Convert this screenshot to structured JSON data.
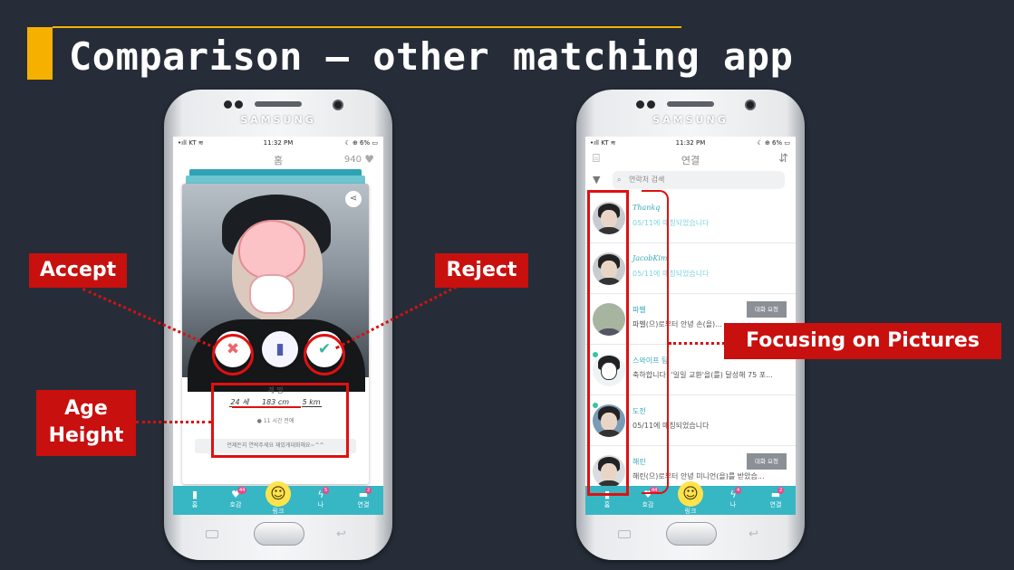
{
  "slide": {
    "title": "Comparison – other matching app",
    "annotations": {
      "accept": "Accept",
      "reject": "Reject",
      "age_line1": "Age",
      "age_line2": "Height",
      "focus": "Focusing on Pictures"
    }
  },
  "colors": {
    "accent": "#f6b100",
    "tag_red": "#c8100f",
    "app_teal": "#37b6c4"
  },
  "phone_left": {
    "brand": "SAMSUNG",
    "status": {
      "carrier": "•ıll KT ≋",
      "time": "11:32 PM",
      "battery": "☾ ⊕ 6% ▭"
    },
    "header": {
      "title": "홈",
      "points": "940",
      "heart_icon": "heart-icon"
    },
    "card": {
      "name": "계 명",
      "age": "24 세",
      "height": "183 cm",
      "distance": "5 km",
      "last_active": "11 시간 전에",
      "message": "언제든지 연락주세요 재밌게대화해요~^^"
    },
    "tabs": [
      {
        "label": "홈",
        "icon": "▮",
        "badge": ""
      },
      {
        "label": "호감",
        "icon": "♥",
        "badge": "44"
      },
      {
        "label": "링크",
        "icon": "☺",
        "badge": ""
      },
      {
        "label": "나",
        "icon": "ϟ",
        "badge": "5"
      },
      {
        "label": "연결",
        "icon": "▬",
        "badge": "2"
      }
    ]
  },
  "phone_right": {
    "brand": "SAMSUNG",
    "status": {
      "carrier": "•ıll KT ≋",
      "time": "11:32 PM",
      "battery": "☾ ⊕ 6% ▭"
    },
    "header": {
      "title": "연결"
    },
    "search": {
      "placeholder": "연락처 검색"
    },
    "chats": [
      {
        "name": "Thankq",
        "message": "05/11에 매칭되었습니다",
        "request": ""
      },
      {
        "name": "JacobKim",
        "message": "05/11에 매칭되었습니다",
        "request": ""
      },
      {
        "name": "파벨",
        "message": "파벨(으)로부터 안녕 손(을)...",
        "request": "대화 요청"
      },
      {
        "name": "스와이프 팀",
        "message": "축하합니다! '일일 교환'을(를) 달성해 75 포...",
        "request": ""
      },
      {
        "name": "도전",
        "message": "05/11에 매칭되었습니다",
        "request": ""
      },
      {
        "name": "해린",
        "message": "해린(으)로부터 안녕 미니언(을)를 받았습...",
        "request": "대화 요청"
      }
    ],
    "tabs": [
      {
        "label": "홈",
        "icon": "▮",
        "badge": ""
      },
      {
        "label": "호감",
        "icon": "♥",
        "badge": "44"
      },
      {
        "label": "링크",
        "icon": "☺",
        "badge": ""
      },
      {
        "label": "나",
        "icon": "ϟ",
        "badge": "4"
      },
      {
        "label": "연결",
        "icon": "▬",
        "badge": "2"
      }
    ]
  }
}
